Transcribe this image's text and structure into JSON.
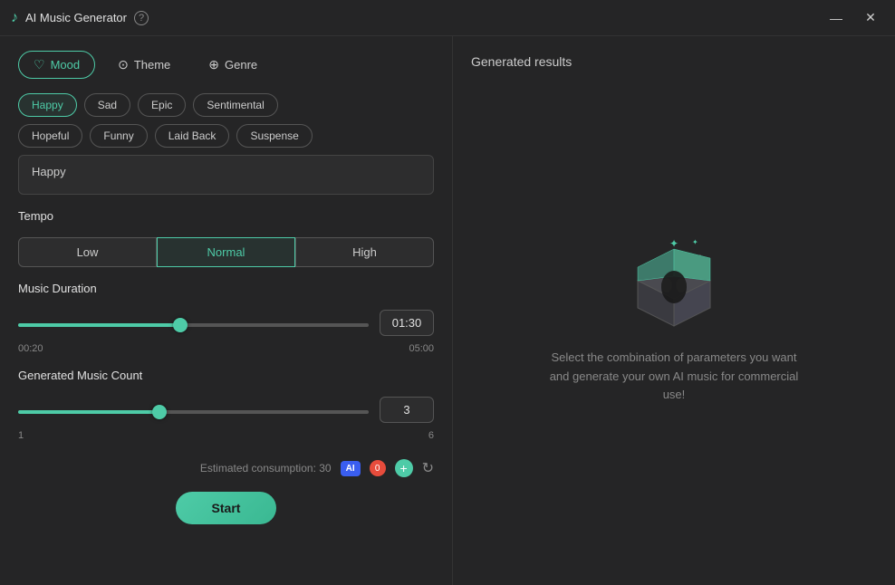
{
  "titlebar": {
    "title": "AI Music Generator",
    "help_icon": "?",
    "minimize_label": "—",
    "close_label": "✕"
  },
  "tabs": [
    {
      "id": "mood",
      "label": "Mood",
      "icon": "♡",
      "active": true
    },
    {
      "id": "theme",
      "label": "Theme",
      "icon": "⊙"
    },
    {
      "id": "genre",
      "label": "Genre",
      "icon": "⊕"
    }
  ],
  "mood": {
    "chips": [
      {
        "label": "Happy",
        "active": true
      },
      {
        "label": "Sad",
        "active": false
      },
      {
        "label": "Epic",
        "active": false
      },
      {
        "label": "Sentimental",
        "active": false
      },
      {
        "label": "Hopeful",
        "active": false
      },
      {
        "label": "Funny",
        "active": false
      },
      {
        "label": "Laid Back",
        "active": false
      },
      {
        "label": "Suspense",
        "active": false
      }
    ],
    "description": "Happy"
  },
  "tempo": {
    "label": "Tempo",
    "options": [
      {
        "label": "Low",
        "active": false
      },
      {
        "label": "Normal",
        "active": true
      },
      {
        "label": "High",
        "active": false
      }
    ]
  },
  "music_duration": {
    "label": "Music Duration",
    "min": "00:20",
    "max": "05:00",
    "value": "01:30",
    "slider_pct": 46
  },
  "music_count": {
    "label": "Generated Music Count",
    "min": "1",
    "max": "6",
    "value": "3",
    "slider_pct": 40
  },
  "bottom": {
    "consumption_label": "Estimated consumption: 30",
    "ai_label": "AI",
    "count_zero": "0",
    "start_label": "Start"
  },
  "right_panel": {
    "results_title": "Generated results",
    "empty_text": "Select the combination of parameters you want and generate your own AI music for commercial use!"
  }
}
